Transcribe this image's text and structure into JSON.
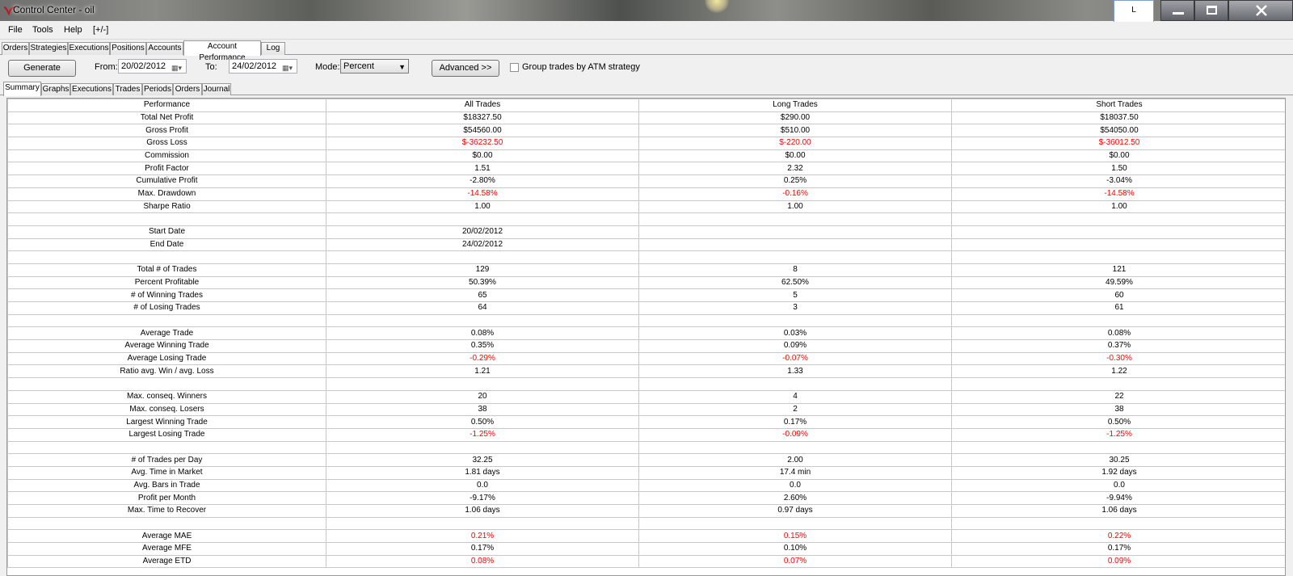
{
  "window": {
    "title": "Control Center - oil",
    "lang_indicator": "L"
  },
  "menu": {
    "file": "File",
    "tools": "Tools",
    "help": "Help",
    "toggle": "[+/-]"
  },
  "main_tabs": [
    "Orders",
    "Strategies",
    "Executions",
    "Positions",
    "Accounts",
    "Account Performance",
    "Log"
  ],
  "toolbar": {
    "generate": "Generate",
    "from_label": "From:",
    "from_value": "20/02/2012",
    "to_label": "To:",
    "to_value": "24/02/2012",
    "mode_label": "Mode:",
    "mode_value": "Percent",
    "advanced": "Advanced >>",
    "group_label": "Group trades by ATM strategy"
  },
  "sub_tabs": [
    "Summary",
    "Graphs",
    "Executions",
    "Trades",
    "Periods",
    "Orders",
    "Journal"
  ],
  "table": {
    "headers": [
      "Performance",
      "All Trades",
      "Long Trades",
      "Short Trades"
    ],
    "rows": [
      {
        "label": "Total Net Profit",
        "all": "$18327.50",
        "long": "$290.00",
        "short": "$18037.50",
        "neg": [
          false,
          false,
          false
        ]
      },
      {
        "label": "Gross Profit",
        "all": "$54560.00",
        "long": "$510.00",
        "short": "$54050.00",
        "neg": [
          false,
          false,
          false
        ]
      },
      {
        "label": "Gross Loss",
        "all": "$-36232.50",
        "long": "$-220.00",
        "short": "$-36012.50",
        "neg": [
          true,
          true,
          true
        ]
      },
      {
        "label": "Commission",
        "all": "$0.00",
        "long": "$0.00",
        "short": "$0.00",
        "neg": [
          false,
          false,
          false
        ]
      },
      {
        "label": "Profit Factor",
        "all": "1.51",
        "long": "2.32",
        "short": "1.50",
        "neg": [
          false,
          false,
          false
        ]
      },
      {
        "label": "Cumulative Profit",
        "all": "-2.80%",
        "long": "0.25%",
        "short": "-3.04%",
        "neg": [
          false,
          false,
          false
        ]
      },
      {
        "label": "Max. Drawdown",
        "all": "-14.58%",
        "long": "-0.16%",
        "short": "-14.58%",
        "neg": [
          true,
          true,
          true
        ]
      },
      {
        "label": "Sharpe Ratio",
        "all": "1.00",
        "long": "1.00",
        "short": "1.00",
        "neg": [
          false,
          false,
          false
        ]
      },
      {
        "label": "",
        "all": "",
        "long": "",
        "short": "",
        "neg": [
          false,
          false,
          false
        ]
      },
      {
        "label": "Start Date",
        "all": "20/02/2012",
        "long": "",
        "short": "",
        "neg": [
          false,
          false,
          false
        ]
      },
      {
        "label": "End Date",
        "all": "24/02/2012",
        "long": "",
        "short": "",
        "neg": [
          false,
          false,
          false
        ]
      },
      {
        "label": "",
        "all": "",
        "long": "",
        "short": "",
        "neg": [
          false,
          false,
          false
        ]
      },
      {
        "label": "Total # of Trades",
        "all": "129",
        "long": "8",
        "short": "121",
        "neg": [
          false,
          false,
          false
        ]
      },
      {
        "label": "Percent Profitable",
        "all": "50.39%",
        "long": "62.50%",
        "short": "49.59%",
        "neg": [
          false,
          false,
          false
        ]
      },
      {
        "label": "# of Winning Trades",
        "all": "65",
        "long": "5",
        "short": "60",
        "neg": [
          false,
          false,
          false
        ]
      },
      {
        "label": "# of Losing Trades",
        "all": "64",
        "long": "3",
        "short": "61",
        "neg": [
          false,
          false,
          false
        ]
      },
      {
        "label": "",
        "all": "",
        "long": "",
        "short": "",
        "neg": [
          false,
          false,
          false
        ]
      },
      {
        "label": "Average Trade",
        "all": "0.08%",
        "long": "0.03%",
        "short": "0.08%",
        "neg": [
          false,
          false,
          false
        ]
      },
      {
        "label": "Average Winning Trade",
        "all": "0.35%",
        "long": "0.09%",
        "short": "0.37%",
        "neg": [
          false,
          false,
          false
        ]
      },
      {
        "label": "Average Losing Trade",
        "all": "-0.29%",
        "long": "-0.07%",
        "short": "-0.30%",
        "neg": [
          true,
          true,
          true
        ]
      },
      {
        "label": "Ratio avg. Win / avg. Loss",
        "all": "1.21",
        "long": "1.33",
        "short": "1.22",
        "neg": [
          false,
          false,
          false
        ]
      },
      {
        "label": "",
        "all": "",
        "long": "",
        "short": "",
        "neg": [
          false,
          false,
          false
        ]
      },
      {
        "label": "Max. conseq. Winners",
        "all": "20",
        "long": "4",
        "short": "22",
        "neg": [
          false,
          false,
          false
        ]
      },
      {
        "label": "Max. conseq. Losers",
        "all": "38",
        "long": "2",
        "short": "38",
        "neg": [
          false,
          false,
          false
        ]
      },
      {
        "label": "Largest Winning Trade",
        "all": "0.50%",
        "long": "0.17%",
        "short": "0.50%",
        "neg": [
          false,
          false,
          false
        ]
      },
      {
        "label": "Largest Losing Trade",
        "all": "-1.25%",
        "long": "-0.09%",
        "short": "-1.25%",
        "neg": [
          true,
          true,
          true
        ]
      },
      {
        "label": "",
        "all": "",
        "long": "",
        "short": "",
        "neg": [
          false,
          false,
          false
        ]
      },
      {
        "label": "# of Trades per Day",
        "all": "32.25",
        "long": "2.00",
        "short": "30.25",
        "neg": [
          false,
          false,
          false
        ]
      },
      {
        "label": "Avg. Time in Market",
        "all": "1.81 days",
        "long": "17.4 min",
        "short": "1.92 days",
        "neg": [
          false,
          false,
          false
        ]
      },
      {
        "label": "Avg. Bars in Trade",
        "all": "0.0",
        "long": "0.0",
        "short": "0.0",
        "neg": [
          false,
          false,
          false
        ]
      },
      {
        "label": "Profit per Month",
        "all": "-9.17%",
        "long": "2.60%",
        "short": "-9.94%",
        "neg": [
          false,
          false,
          false
        ]
      },
      {
        "label": "Max. Time to Recover",
        "all": "1.06 days",
        "long": "0.97 days",
        "short": "1.06 days",
        "neg": [
          false,
          false,
          false
        ]
      },
      {
        "label": "",
        "all": "",
        "long": "",
        "short": "",
        "neg": [
          false,
          false,
          false
        ]
      },
      {
        "label": "Average MAE",
        "all": "0.21%",
        "long": "0.15%",
        "short": "0.22%",
        "neg": [
          true,
          true,
          true
        ]
      },
      {
        "label": "Average MFE",
        "all": "0.17%",
        "long": "0.10%",
        "short": "0.17%",
        "neg": [
          false,
          false,
          false
        ]
      },
      {
        "label": "Average ETD",
        "all": "0.08%",
        "long": "0.07%",
        "short": "0.09%",
        "neg": [
          true,
          true,
          true
        ]
      }
    ]
  },
  "colors": {
    "negative": "#ff0000",
    "app_icon": "#c0171c"
  }
}
